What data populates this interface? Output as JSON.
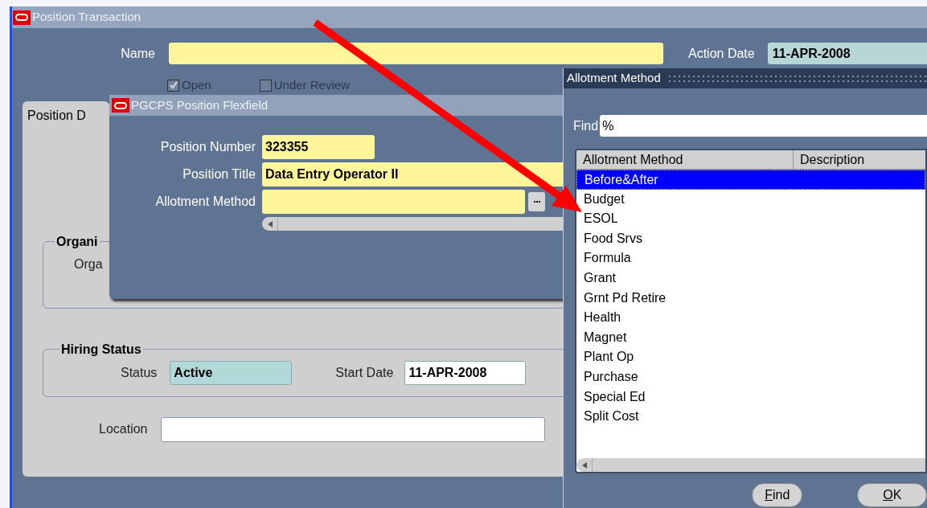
{
  "main_window": {
    "title": "Position Transaction",
    "name_label": "Name",
    "action_date_label": "Action Date",
    "action_date": "11-APR-2008",
    "checkboxes": [
      {
        "label": "Open",
        "checked": true
      },
      {
        "label": "Under Review",
        "checked": false
      }
    ],
    "tab": {
      "label": "Position D",
      "selected": true
    },
    "organization_group": {
      "title": "Organi",
      "field_label": "Orga"
    },
    "hiring_status": {
      "title": "Hiring Status",
      "status_label": "Status",
      "status": "Active",
      "start_date_label": "Start Date",
      "start_date": "11-APR-2008"
    },
    "location_label": "Location"
  },
  "flexfield": {
    "title": "PGCPS Position Flexfield",
    "fields": [
      {
        "label": "Position Number",
        "value": "323355",
        "kind": "short"
      },
      {
        "label": "Position Title",
        "value": "Data Entry Operator II",
        "kind": "long"
      },
      {
        "label": "Allotment Method",
        "kind": "lov"
      }
    ]
  },
  "lov": {
    "title": "Allotment Method",
    "find_label": "Find",
    "find_value": "%",
    "columns": [
      "Allotment Method",
      "Description"
    ],
    "rows": [
      {
        "text": "Before&After",
        "selected": true
      },
      {
        "text": "Budget",
        "selected": false
      },
      {
        "text": "ESOL",
        "selected": false
      },
      {
        "text": "Food Srvs",
        "selected": false
      },
      {
        "text": "Formula",
        "selected": false
      },
      {
        "text": "Grant",
        "selected": false
      },
      {
        "text": "Grnt Pd Retire",
        "selected": false
      },
      {
        "text": "Health",
        "selected": false
      },
      {
        "text": "Magnet",
        "selected": false
      },
      {
        "text": "Plant Op",
        "selected": false
      },
      {
        "text": "Purchase",
        "selected": false
      },
      {
        "text": "Special Ed",
        "selected": false
      },
      {
        "text": "Split Cost",
        "selected": false
      }
    ],
    "buttons": [
      {
        "label": "Find"
      },
      {
        "label": "OK"
      }
    ]
  }
}
